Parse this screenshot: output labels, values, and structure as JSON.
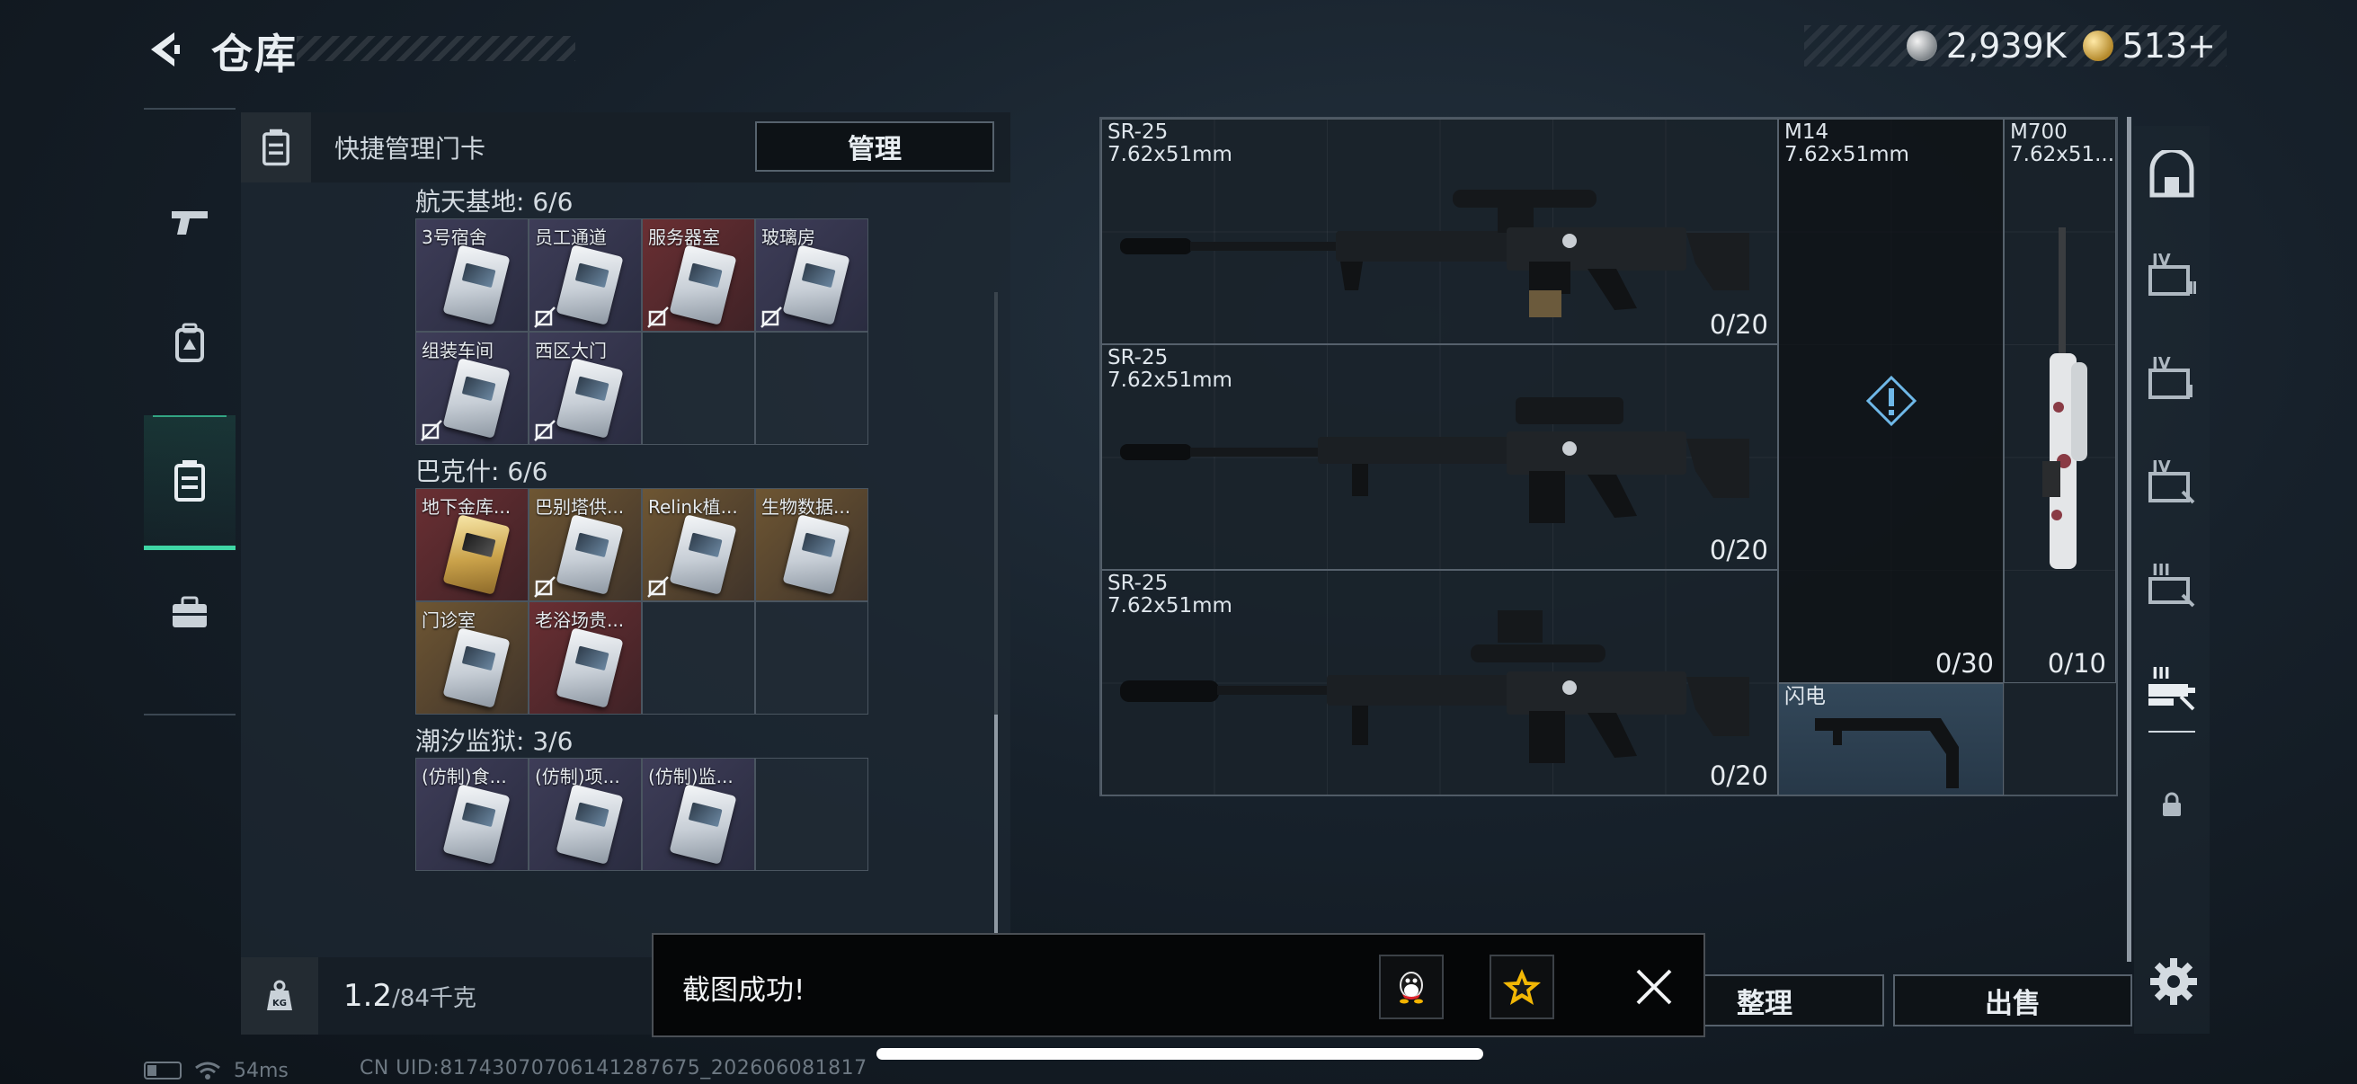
{
  "header": {
    "title": "仓库",
    "back_icon": "chevron-left-icon",
    "currency": [
      {
        "icon": "silver-coin-icon",
        "value": "2,939K"
      },
      {
        "icon": "gold-coin-icon",
        "value": "513+"
      }
    ]
  },
  "left_rail": [
    {
      "icon": "pistol-icon",
      "active": false
    },
    {
      "icon": "backpack-icon",
      "active": false
    },
    {
      "icon": "keycard-case-icon",
      "active": true
    },
    {
      "icon": "toolbox-icon",
      "active": false
    }
  ],
  "card_panel": {
    "header_label": "快捷管理门卡",
    "manage_label": "管理",
    "sections": [
      {
        "title": "航天基地: 6/6",
        "cards": [
          {
            "name": "3号宿舍",
            "rarity": "purple",
            "nolink": false
          },
          {
            "name": "员工通道",
            "rarity": "purple",
            "nolink": true
          },
          {
            "name": "服务器室",
            "rarity": "red",
            "nolink": true
          },
          {
            "name": "玻璃房",
            "rarity": "purple",
            "nolink": true
          },
          {
            "name": "组装车间",
            "rarity": "purple",
            "nolink": true
          },
          {
            "name": "西区大门",
            "rarity": "purple",
            "nolink": true
          }
        ]
      },
      {
        "title": "巴克什: 6/6",
        "cards": [
          {
            "name": "地下金库...",
            "rarity": "red",
            "nolink": false,
            "golden": true
          },
          {
            "name": "巴别塔供...",
            "rarity": "gold",
            "nolink": true
          },
          {
            "name": "Relink植...",
            "rarity": "gold",
            "nolink": true
          },
          {
            "name": "生物数据...",
            "rarity": "gold",
            "nolink": false
          },
          {
            "name": "门诊室",
            "rarity": "gold",
            "nolink": false
          },
          {
            "name": "老浴场贵...",
            "rarity": "red",
            "nolink": false
          }
        ]
      },
      {
        "title": "潮汐监狱: 3/6",
        "cards": [
          {
            "name": "(仿制)食...",
            "rarity": "purple",
            "nolink": false
          },
          {
            "name": "(仿制)项...",
            "rarity": "purple",
            "nolink": false
          },
          {
            "name": "(仿制)监...",
            "rarity": "purple",
            "nolink": false
          }
        ]
      }
    ],
    "capacity": {
      "used": "1.2",
      "total": "/84千克"
    }
  },
  "weapons": [
    {
      "name": "SR-25",
      "caliber": "7.62x51mm",
      "ammo": "0/20"
    },
    {
      "name": "SR-25",
      "caliber": "7.62x51mm",
      "ammo": "0/20"
    },
    {
      "name": "SR-25",
      "caliber": "7.62x51mm",
      "ammo": "0/20"
    },
    {
      "name": "M14",
      "caliber": "7.62x51mm",
      "ammo": "0/30"
    },
    {
      "name": "M700",
      "caliber": "7.62x51...",
      "ammo": "0/10"
    },
    {
      "name": "闪电",
      "caliber": "",
      "ammo": ""
    }
  ],
  "right_rail": [
    {
      "icon": "safe-icon"
    },
    {
      "icon": "container-tier-4-icon",
      "tier": "IV"
    },
    {
      "icon": "container-tier-4-icon",
      "tier": "IV"
    },
    {
      "icon": "container-tier-4-icon",
      "tier": "IV"
    },
    {
      "icon": "container-tier-3-icon",
      "tier": "III"
    },
    {
      "icon": "container-tier-3-icon",
      "tier": "III"
    },
    {
      "icon": "lock-icon"
    }
  ],
  "actions": {
    "sort_label": "整理",
    "sell_label": "出售"
  },
  "toast": {
    "message": "截图成功!",
    "share_icons": [
      "qq-icon",
      "favorite-star-icon"
    ]
  },
  "status": {
    "ping": "54ms",
    "uid": "CN UID:8174307070614128767​5_202606081817"
  },
  "colors": {
    "accent_green": "#3fd6a5",
    "rarity_red": "#6a2f33",
    "rarity_gold": "#6e5633",
    "rarity_purple": "#3e3d58"
  }
}
